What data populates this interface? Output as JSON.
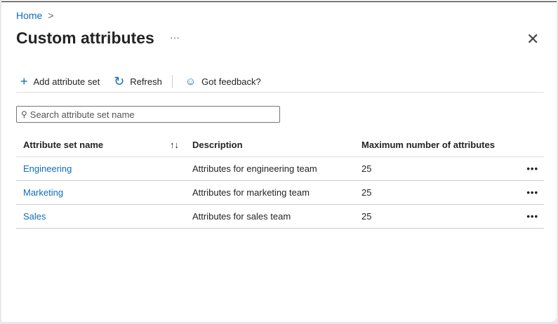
{
  "breadcrumb": {
    "home": "Home",
    "chevron": ">"
  },
  "title": "Custom attributes",
  "more": "···",
  "close": "✕",
  "toolbar": {
    "add": "Add attribute set",
    "refresh": "Refresh",
    "feedback": "Got feedback?"
  },
  "search": {
    "placeholder": "Search attribute set name"
  },
  "table": {
    "headers": [
      "Attribute set name",
      "Description",
      "Maximum number of attributes"
    ],
    "sort_icon": "↑↓",
    "rows": [
      {
        "name": "Engineering",
        "description": "Attributes for engineering team",
        "max": "25"
      },
      {
        "name": "Marketing",
        "description": "Attributes for marketing team",
        "max": "25"
      },
      {
        "name": "Sales",
        "description": "Attributes for sales team",
        "max": "25"
      }
    ],
    "row_menu": "•••"
  }
}
